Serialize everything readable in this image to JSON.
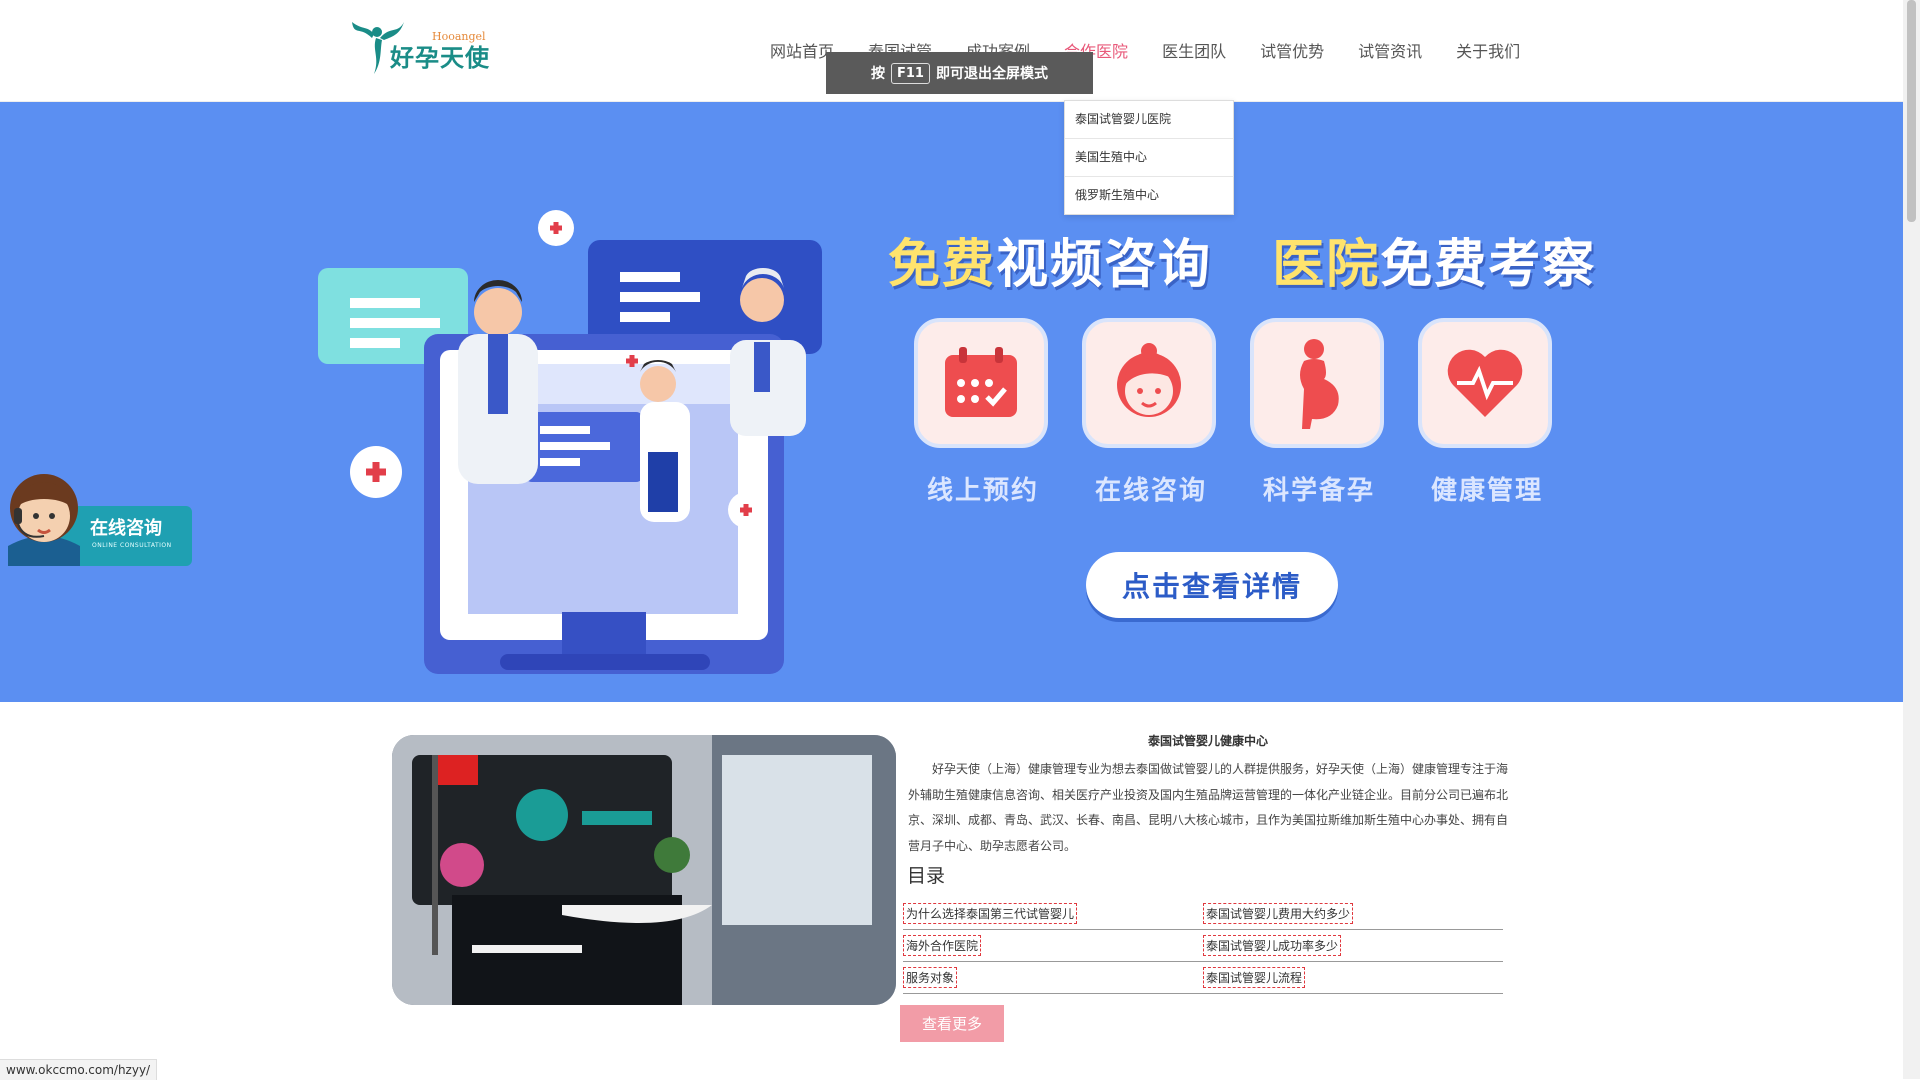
{
  "logo": {
    "cn": "好孕天使",
    "en": "Hooangel"
  },
  "nav": [
    {
      "label": "网站首页"
    },
    {
      "label": "泰国试管"
    },
    {
      "label": "成功案例"
    },
    {
      "label": "合作医院"
    },
    {
      "label": "医生团队"
    },
    {
      "label": "试管优势"
    },
    {
      "label": "试管资讯"
    },
    {
      "label": "关于我们"
    }
  ],
  "toast": {
    "prefix": "按",
    "key": "F11",
    "suffix": "即可退出全屏模式"
  },
  "dropdown": [
    {
      "label": "泰国试管婴儿医院"
    },
    {
      "label": "美国生殖中心"
    },
    {
      "label": "俄罗斯生殖中心"
    }
  ],
  "banner": {
    "headline_1_y": "免费",
    "headline_1_w": "视频咨询",
    "headline_2_y": "医院",
    "headline_2_w": "免费考察",
    "features": [
      {
        "label": "线上预约",
        "icon": "calendar-icon"
      },
      {
        "label": "在线咨询",
        "icon": "consultant-face-icon"
      },
      {
        "label": "科学备孕",
        "icon": "pregnant-woman-icon"
      },
      {
        "label": "健康管理",
        "icon": "heart-pulse-icon"
      }
    ],
    "cta": "点击查看详情"
  },
  "side_consult": {
    "title": "在线咨询",
    "subtitle": "ONLINE CONSULTATION"
  },
  "about": {
    "title": "泰国试管婴儿健康中心",
    "text": "好孕天使（上海）健康管理专业为想去泰国做试管婴儿的人群提供服务，好孕天使（上海）健康管理专注于海外辅助生殖健康信息咨询、相关医疗产业投资及国内生殖品牌运营管理的一体化产业链企业。目前分公司已遍布北京、深圳、成都、青岛、武汉、长春、南昌、昆明八大核心城市，且作为美国拉斯维加斯生殖中心办事处、拥有自营月子中心、助孕志愿者公司。",
    "toc_title": "目录",
    "toc": [
      [
        "为什么选择泰国第三代试管婴儿",
        "泰国试管婴儿费用大约多少"
      ],
      [
        "海外合作医院",
        "泰国试管婴儿成功率多少"
      ],
      [
        "服务对象",
        "泰国试管婴儿流程"
      ]
    ],
    "more": "查看更多"
  },
  "status_url": "www.okccmo.com/hzyy/"
}
